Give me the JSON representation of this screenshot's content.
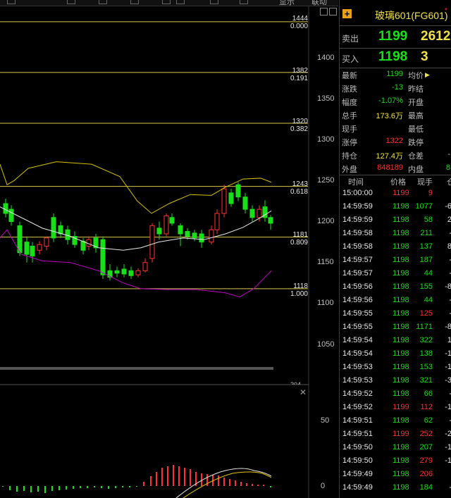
{
  "top_toolbar": {
    "partial_labels": [
      "显示",
      "联动"
    ]
  },
  "chart": {
    "fib_levels": [
      {
        "price": "1444",
        "ratio": "0.000"
      },
      {
        "price": "1382",
        "ratio": "0.191"
      },
      {
        "price": "1320",
        "ratio": "0.382"
      },
      {
        "price": "1243",
        "ratio": "0.618"
      },
      {
        "price": "1181",
        "ratio": "0.809"
      },
      {
        "price": "1118",
        "ratio": "1.000"
      }
    ],
    "price_axis": [
      "1400",
      "1350",
      "1300",
      "1250",
      "1200",
      "1150",
      "1100",
      "1050"
    ],
    "indicator_axis": [
      "50",
      "0"
    ],
    "indicator_top_partial": "204",
    "colors": {
      "up": "#ff3232",
      "down": "#18e018",
      "fib": "#d8c84a",
      "boll_upper": "#d6c100",
      "boll_mid": "#e8e8e8",
      "boll_lower": "#c000c0"
    }
  },
  "quote": {
    "title": "玻璃601(FG601)",
    "title_mark": "*",
    "sell": {
      "label": "卖出",
      "price": "1199",
      "volume": "2612"
    },
    "buy": {
      "label": "买入",
      "price": "1198",
      "volume": "3"
    },
    "fields": [
      {
        "label": "最新",
        "value": "1199",
        "label2": "均价",
        "value2": ""
      },
      {
        "label": "涨跌",
        "value": "-13",
        "label2": "昨结",
        "value2": ""
      },
      {
        "label": "幅度",
        "value": "-1.07%",
        "label2": "开盘",
        "value2": ""
      },
      {
        "label": "总手",
        "value": "173.6万",
        "label2": "最高",
        "value2": ""
      },
      {
        "label": "现手",
        "value": "",
        "label2": "最低",
        "value2": ""
      },
      {
        "label": "涨停",
        "value": "1322",
        "label2": "跌停",
        "value2": ""
      },
      {
        "label": "持仓",
        "value": "127.4万",
        "label2": "仓差",
        "value2": "-"
      },
      {
        "label": "外盘",
        "value": "848189",
        "label2": "内盘",
        "value2": "8"
      }
    ]
  },
  "ticks": {
    "headers": [
      "时间",
      "价格",
      "现手",
      "仓"
    ],
    "rows": [
      {
        "time": "15:00:00",
        "price": "1199",
        "vol": "9",
        "oi": "",
        "dir": "up"
      },
      {
        "time": "14:59:59",
        "price": "1198",
        "vol": "1077",
        "oi": "-6",
        "dir": "down"
      },
      {
        "time": "14:59:59",
        "price": "1198",
        "vol": "58",
        "oi": "2",
        "dir": "down"
      },
      {
        "time": "14:59:58",
        "price": "1198",
        "vol": "211",
        "oi": "-",
        "dir": "down"
      },
      {
        "time": "14:59:58",
        "price": "1198",
        "vol": "137",
        "oi": "8",
        "dir": "down"
      },
      {
        "time": "14:59:57",
        "price": "1198",
        "vol": "187",
        "oi": "-",
        "dir": "down"
      },
      {
        "time": "14:59:57",
        "price": "1198",
        "vol": "44",
        "oi": "-",
        "dir": "down"
      },
      {
        "time": "14:59:56",
        "price": "1198",
        "vol": "155",
        "oi": "-8",
        "dir": "down"
      },
      {
        "time": "14:59:56",
        "price": "1198",
        "vol": "44",
        "oi": "-",
        "dir": "down"
      },
      {
        "time": "14:59:55",
        "price": "1198",
        "vol": "125",
        "oi": "-",
        "dir": "up"
      },
      {
        "time": "14:59:55",
        "price": "1198",
        "vol": "1171",
        "oi": "-8",
        "dir": "down"
      },
      {
        "time": "14:59:54",
        "price": "1198",
        "vol": "322",
        "oi": "1",
        "dir": "down"
      },
      {
        "time": "14:59:54",
        "price": "1198",
        "vol": "138",
        "oi": "-1",
        "dir": "down"
      },
      {
        "time": "14:59:53",
        "price": "1198",
        "vol": "153",
        "oi": "-1",
        "dir": "down"
      },
      {
        "time": "14:59:53",
        "price": "1198",
        "vol": "321",
        "oi": "-3",
        "dir": "down"
      },
      {
        "time": "14:59:52",
        "price": "1198",
        "vol": "66",
        "oi": "-",
        "dir": "down"
      },
      {
        "time": "14:59:52",
        "price": "1199",
        "vol": "112",
        "oi": "-1",
        "dir": "up"
      },
      {
        "time": "14:59:51",
        "price": "1198",
        "vol": "62",
        "oi": "-",
        "dir": "down"
      },
      {
        "time": "14:59:51",
        "price": "1199",
        "vol": "252",
        "oi": "-2",
        "dir": "up"
      },
      {
        "time": "14:59:50",
        "price": "1198",
        "vol": "207",
        "oi": "-1",
        "dir": "down"
      },
      {
        "time": "14:59:50",
        "price": "1198",
        "vol": "279",
        "oi": "-1",
        "dir": "up"
      },
      {
        "time": "14:59:49",
        "price": "1198",
        "vol": "206",
        "oi": "",
        "dir": "up"
      },
      {
        "time": "14:59:49",
        "price": "1198",
        "vol": "184",
        "oi": "-",
        "dir": "down"
      }
    ]
  }
}
